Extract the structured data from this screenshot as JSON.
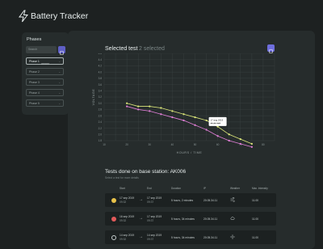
{
  "app": {
    "title": "Battery Tracker"
  },
  "phases": {
    "title": "Phases",
    "search_placeholder": "Search",
    "items": [
      {
        "label": "Phase 1",
        "tag": "######",
        "selected": true
      },
      {
        "label": "Phase 2",
        "selected": false
      },
      {
        "label": "Phase 3",
        "selected": false
      },
      {
        "label": "Phase 4",
        "selected": false
      },
      {
        "label": "Phase 5",
        "selected": false
      }
    ]
  },
  "selected_test": {
    "title": "Selected test",
    "count_label": "2 selected"
  },
  "chart_data": {
    "type": "line",
    "title": "",
    "xlabel": "HOURS / TIME",
    "ylabel": "VOLTAGE",
    "x_ticks": [
      "10",
      "15",
      "20",
      "25",
      "30",
      "35",
      "40",
      "45",
      "50",
      "55",
      "60",
      "65",
      "70",
      "75",
      "80",
      "85"
    ],
    "y_ticks": [
      "4.6",
      "4.4",
      "4.2",
      "4.0",
      "3.8",
      "3.6",
      "3.4",
      "3.2",
      "3.0",
      "2.8",
      "2.6",
      "2.4",
      "2.2",
      "2.0",
      "1.8"
    ],
    "x": [
      20,
      25,
      30,
      35,
      40,
      45,
      50,
      55,
      60,
      65,
      70,
      75
    ],
    "series": [
      {
        "name": "",
        "color": "#dde87a",
        "values": [
          3.0,
          2.9,
          2.9,
          2.85,
          2.75,
          2.65,
          2.55,
          2.45,
          2.25,
          2.0,
          1.85,
          1.7
        ]
      },
      {
        "name": "",
        "color": "#e27fd8",
        "values": [
          2.9,
          2.8,
          2.75,
          2.65,
          2.55,
          2.45,
          2.3,
          2.15,
          1.95,
          1.8,
          1.7,
          1.6
        ]
      }
    ],
    "tooltip": {
      "lines": [
        "17 aug 2019",
        "##:## ###"
      ]
    },
    "grid": true
  },
  "tests": {
    "title": "Tests done on base station: AK006",
    "subtitle": "Select a test for more details",
    "columns": [
      "Start",
      "End",
      "Duration",
      "IP",
      "Weather",
      "Max. Intensity"
    ],
    "rows": [
      {
        "color": "#e8c24a",
        "start_date": "17 sep 2019",
        "start_time": "09:32",
        "end_date": "17 sep 2019",
        "end_time": "09:37",
        "duration": "5 hours, 2 minutes",
        "ip": "20.05.34.11",
        "weather": "wind",
        "max": "11.00"
      },
      {
        "color": "#e25a5a",
        "start_date": "16 sep 2019",
        "start_time": "09:32",
        "end_date": "17 sep 2019",
        "end_time": "09:37",
        "duration": "5 hours, 34 minutes",
        "ip": "20.05.34.11",
        "weather": "cloud",
        "max": "11.00"
      },
      {
        "color": "none",
        "start_date": "14 sep 2019",
        "start_time": "09:32",
        "end_date": "14 sep 2019",
        "end_time": "09:37",
        "duration": "5 hours, 34 minutes",
        "ip": "20.05.34.11",
        "weather": "sun",
        "max": "11.00"
      }
    ]
  }
}
